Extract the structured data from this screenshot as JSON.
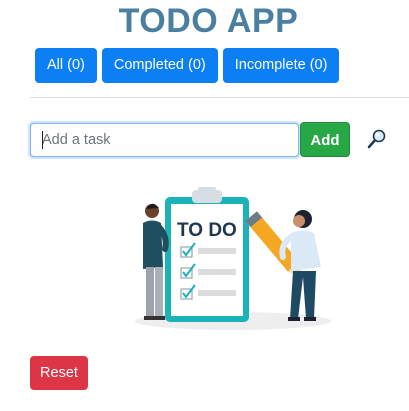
{
  "app": {
    "title": "TODO APP"
  },
  "filters": {
    "all_label": "All (0)",
    "completed_label": "Completed (0)",
    "incomplete_label": "Incomplete (0)"
  },
  "task_form": {
    "input_value": "",
    "input_placeholder": "Add a task",
    "add_label": "Add",
    "search_icon": "search-icon"
  },
  "illustration": {
    "clipboard_text": "TO DO"
  },
  "footer": {
    "reset_label": "Reset"
  },
  "colors": {
    "title": "#4a7fa0",
    "primary": "#0d7ff5",
    "success": "#28a745",
    "danger": "#dc3545",
    "teal": "#19b3b9"
  }
}
